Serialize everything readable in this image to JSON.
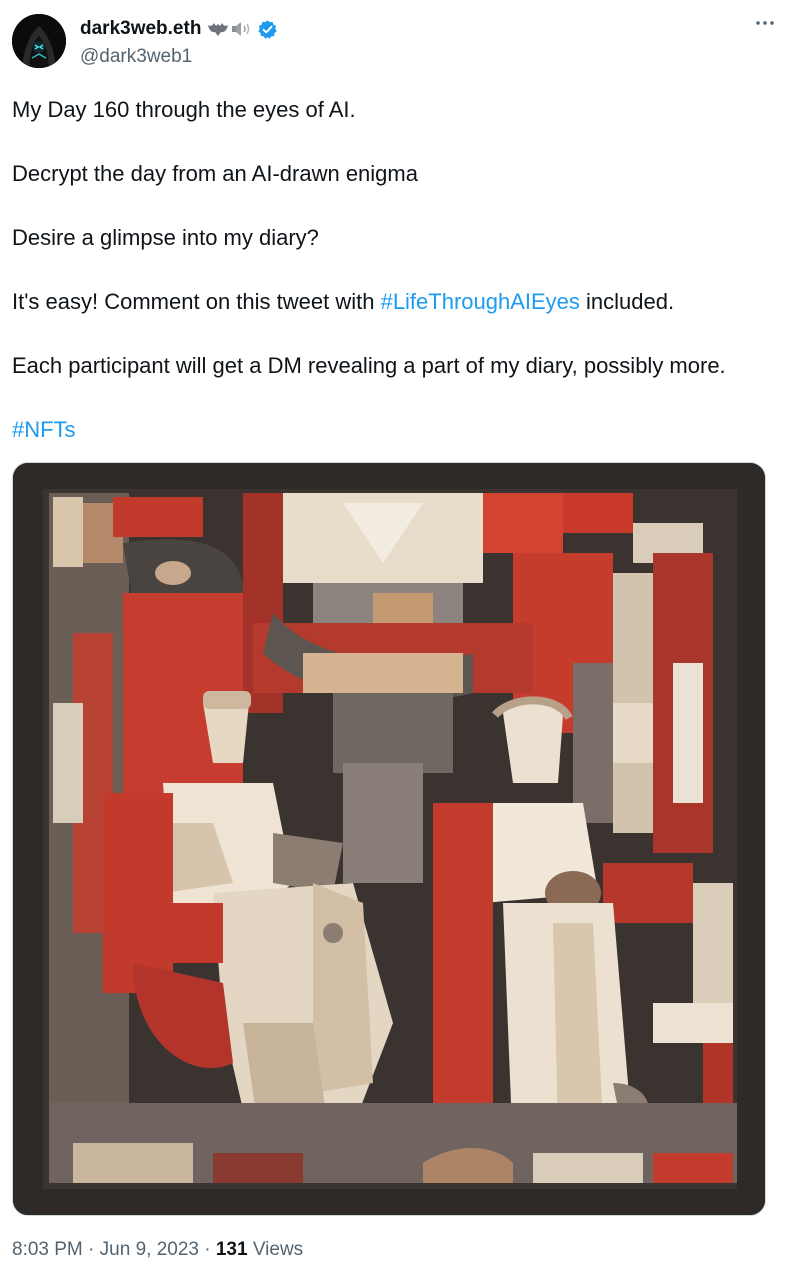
{
  "author": {
    "display_name": "dark3web.eth",
    "handle": "@dark3web1",
    "name_emoji_icons": [
      "bat-icon",
      "speaker-icon"
    ],
    "verified_icon": "verified-badge-icon",
    "verified_color": "#1d9bf0"
  },
  "menu": {
    "icon": "more-horizontal-icon"
  },
  "tweet": {
    "line1": "My Day 160 through the eyes of AI.",
    "line2": "Decrypt the day from an AI-drawn enigma",
    "line3": "Desire a glimpse into my diary?",
    "line4_before": "It's easy! Comment on this tweet with ",
    "line4_hashtag": "#LifeThroughAIEyes",
    "line4_after": " included.",
    "line5": "Each participant will get a DM revealing a part of my diary, possibly more.",
    "hashtag_footer": "#NFTs",
    "hashtag_color": "#1d9bf0"
  },
  "footer": {
    "time": "8:03 PM",
    "sep1": " · ",
    "date": "Jun 9, 2023",
    "sep2": " · ",
    "views_count": "131",
    "views_label": " Views"
  }
}
